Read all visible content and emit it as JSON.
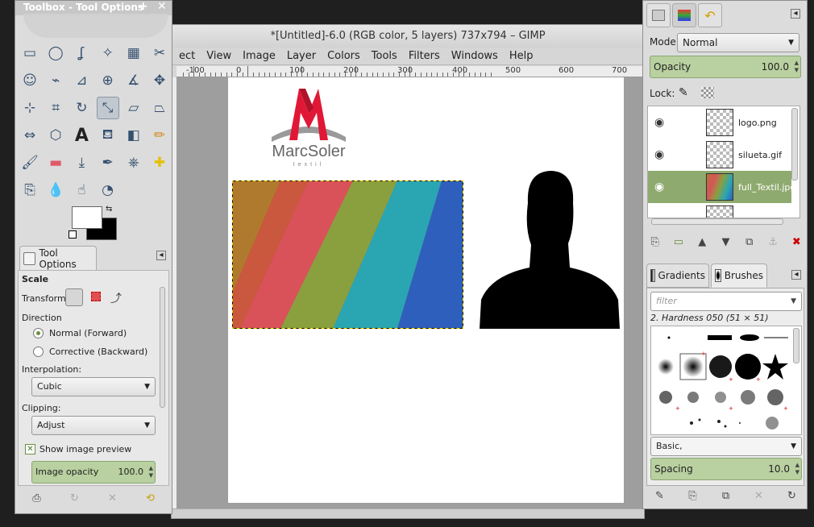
{
  "toolbox": {
    "title": "Toolbox - Tool Options",
    "tools": [
      "rect-select-icon",
      "ellipse-select-icon",
      "free-select-icon",
      "fuzzy-select-icon",
      "color-select-icon",
      "scissors-icon",
      "foreground-select-icon",
      "paths-icon",
      "color-picker-icon",
      "zoom-icon",
      "measure-icon",
      "move-icon",
      "align-icon",
      "crop-icon",
      "rotate-icon",
      "scale-icon",
      "shear-icon",
      "perspective-icon",
      "flip-icon",
      "cage-icon",
      "text-icon",
      "bucket-fill-icon",
      "blend-icon",
      "pencil-icon",
      "paintbrush-icon",
      "eraser-icon",
      "airbrush-icon",
      "ink-icon",
      "clone-icon",
      "heal-icon",
      "perspective-clone-icon",
      "blur-icon",
      "smudge-icon",
      "dodge-burn-icon"
    ],
    "active_tool_index": 15,
    "tool_options": {
      "tab_label": "Tool Options",
      "heading": "Scale",
      "transform_label": "Transform:",
      "direction_label": "Direction",
      "direction_normal": "Normal (Forward)",
      "direction_corrective": "Corrective (Backward)",
      "interpolation_label": "Interpolation:",
      "interpolation_value": "Cubic",
      "clipping_label": "Clipping:",
      "clipping_value": "Adjust",
      "show_preview_label": "Show image preview",
      "image_opacity_label": "Image opacity",
      "image_opacity_value": "100.0"
    }
  },
  "image_window": {
    "title": "*[Untitled]-6.0 (RGB color, 5 layers) 737x794 – GIMP",
    "menu": [
      "ect",
      "View",
      "Image",
      "Layer",
      "Colors",
      "Tools",
      "Filters",
      "Windows",
      "Help"
    ],
    "ruler_labels": [
      "-100",
      "0",
      "100",
      "200",
      "300",
      "400",
      "500",
      "600",
      "700"
    ],
    "canvas": {
      "logo_text": "MarcSoler",
      "logo_subtext": "textil"
    }
  },
  "layers": {
    "mode_label": "Mode:",
    "mode_value": "Normal",
    "opacity_label": "Opacity",
    "opacity_value": "100.0",
    "lock_label": "Lock:",
    "items": [
      {
        "name": "logo.png",
        "selected": false
      },
      {
        "name": "silueta.gif",
        "selected": false
      },
      {
        "name": "full_Textil.jpg",
        "selected": true
      },
      {
        "name": "",
        "selected": false
      }
    ]
  },
  "brushes": {
    "tab_gradients": "Gradients",
    "tab_brushes": "Brushes",
    "filter_placeholder": "filter",
    "current_brush": "2. Hardness 050 (51 × 51)",
    "preset_value": "Basic,",
    "spacing_label": "Spacing",
    "spacing_value": "10.0"
  },
  "colors": {
    "accent_green": "#8faa6e",
    "foreground": "#ffffff",
    "background": "#000000"
  }
}
